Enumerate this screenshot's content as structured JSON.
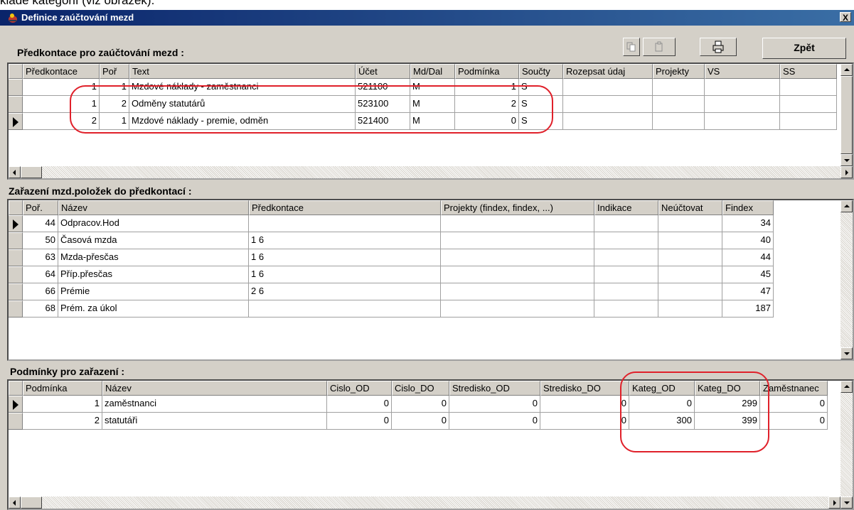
{
  "cut_text": "klade kategorií (viz obrázek).",
  "window": {
    "title": "Definice zaúčtování mezd",
    "close_label": "X"
  },
  "toolbar": {
    "back_label": "Zpět"
  },
  "section1": {
    "label": "Předkontace  pro zaúčtování mezd :",
    "columns": [
      "Předkontace",
      "Poř",
      "Text",
      "Účet",
      "Md/Dal",
      "Podmínka",
      "Součty",
      "Rozepsat údaj",
      "Projekty",
      "VS",
      "SS"
    ],
    "rows": [
      [
        "1",
        "1",
        "Mzdové náklady - zaměstnanci",
        "521100",
        "M",
        "1",
        "S",
        "",
        "",
        "",
        ""
      ],
      [
        "1",
        "2",
        "Odměny statutárů",
        "523100",
        "M",
        "2",
        "S",
        "",
        "",
        "",
        ""
      ],
      [
        "2",
        "1",
        "Mzdové náklady - premie, odměn",
        "521400",
        "M",
        "0",
        "S",
        "",
        "",
        "",
        ""
      ]
    ],
    "current_row": 2
  },
  "section2": {
    "label": "Zařazení mzd.položek do předkontací :",
    "columns": [
      "Poř.",
      "Název",
      "Předkontace",
      "Projekty (findex, findex, ...)",
      "Indikace",
      "Neúčtovat",
      "Findex"
    ],
    "rows": [
      [
        "44",
        "Odpracov.Hod",
        "",
        "",
        "",
        "",
        "34"
      ],
      [
        "50",
        "Časová mzda",
        "1 6",
        "",
        "",
        "",
        "40"
      ],
      [
        "63",
        "Mzda-přesčas",
        "1 6",
        "",
        "",
        "",
        "44"
      ],
      [
        "64",
        "Příp.přesčas",
        "1 6",
        "",
        "",
        "",
        "45"
      ],
      [
        "66",
        "Prémie",
        "2 6",
        "",
        "",
        "",
        "47"
      ],
      [
        "68",
        "Prém. za úkol",
        "",
        "",
        "",
        "",
        "187"
      ]
    ],
    "current_row": 0
  },
  "section3": {
    "label": "Podmínky pro zařazení :",
    "columns": [
      "Podmínka",
      "Název",
      "Cislo_OD",
      "Cislo_DO",
      "Stredisko_OD",
      "Stredisko_DO",
      "Kateg_OD",
      "Kateg_DO",
      "Zaměstnanec"
    ],
    "rows": [
      [
        "1",
        "zaměstnanci",
        "0",
        "0",
        "0",
        "0",
        "0",
        "299",
        "0"
      ],
      [
        "2",
        "statutáři",
        "0",
        "0",
        "0",
        "0",
        "300",
        "399",
        "0"
      ]
    ],
    "current_row": 0
  },
  "colors": {
    "title_bar": "#0a246a",
    "annotation": "#e0202a",
    "face": "#d4d0c8"
  }
}
